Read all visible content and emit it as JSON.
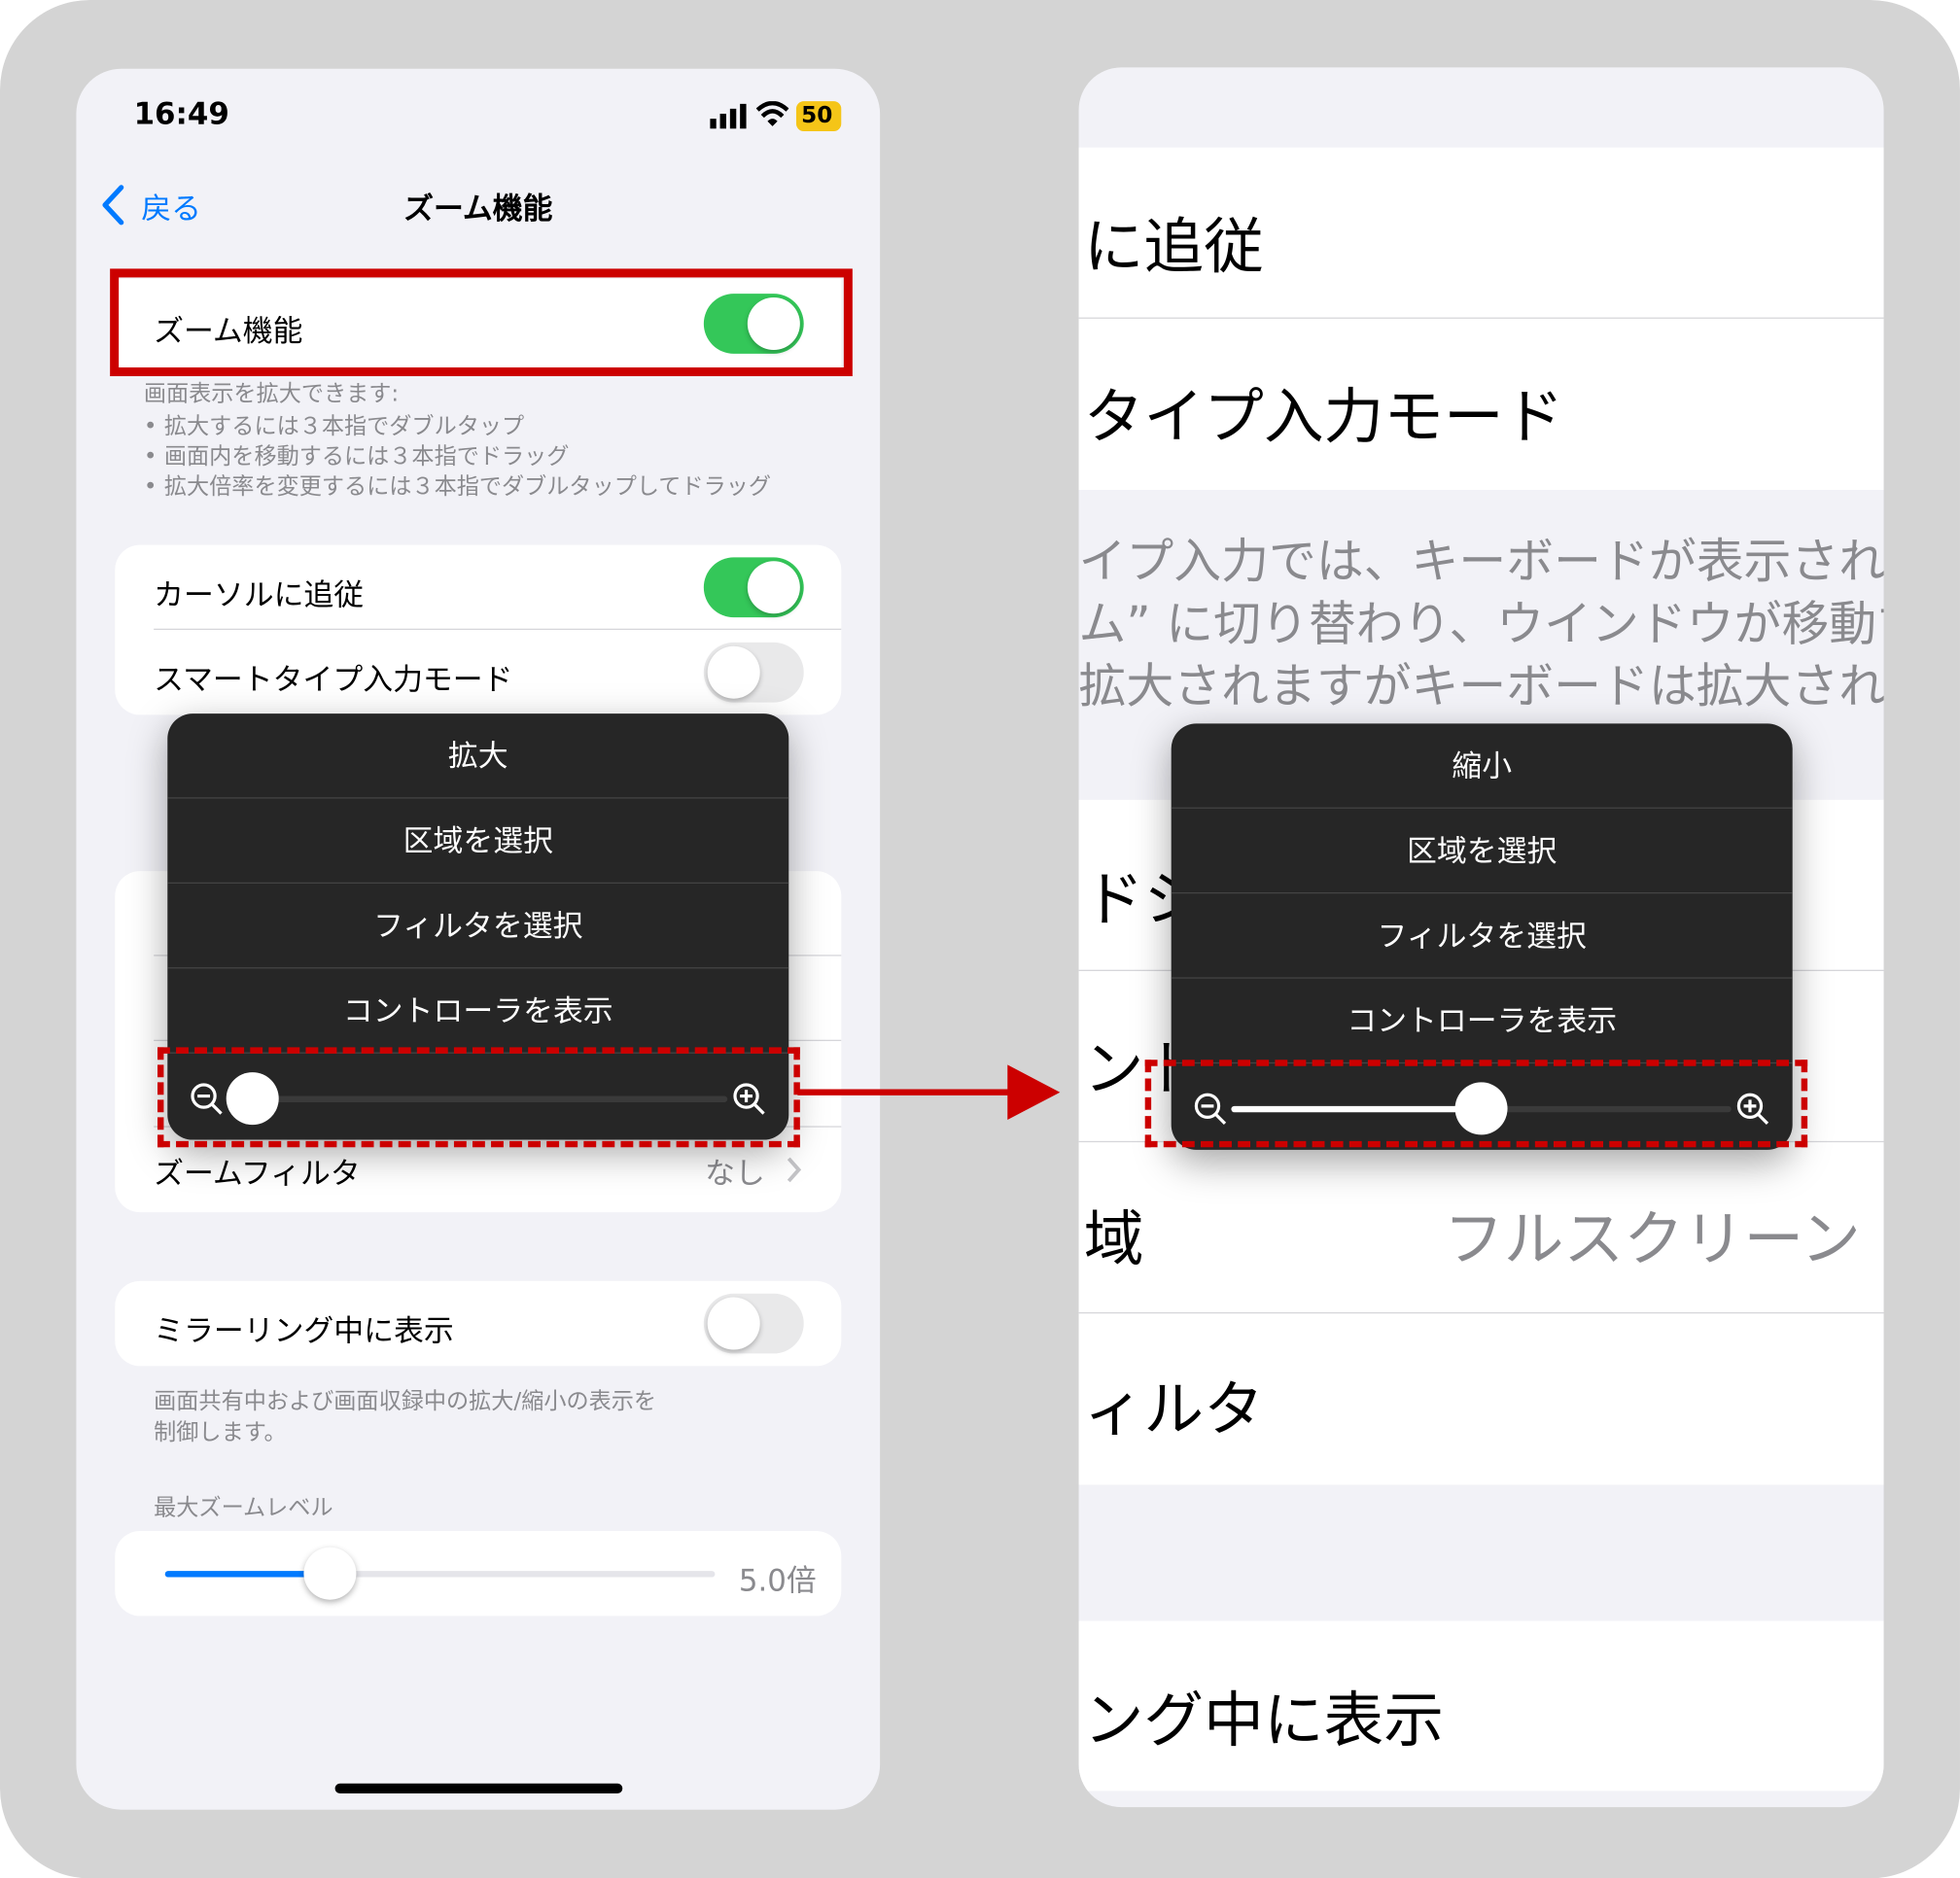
{
  "status_bar": {
    "time": "16:49",
    "battery": "50"
  },
  "nav": {
    "back_label": "戻る",
    "title": "ズーム機能"
  },
  "zoom_row": {
    "label": "ズーム機能"
  },
  "zoom_footer": {
    "heading": "画面表示を拡大できます:",
    "bullets": [
      "拡大するには３本指でダブルタップ",
      "画面内を移動するには３本指でドラッグ",
      "拡大倍率を変更するには３本指でダブルタップしてドラッグ"
    ]
  },
  "group2": {
    "follow_focus": "カーソルに追従",
    "smart_typing": "スマートタイプ入力モード"
  },
  "group3": {
    "zoom_filter": "ズームフィルタ",
    "zoom_filter_value": "なし"
  },
  "mirroring": {
    "label": "ミラーリング中に表示",
    "footer_line1": "画面共有中および画面収録中の拡大/縮小の表示を",
    "footer_line2": "制御します。"
  },
  "max_zoom": {
    "header": "最大ズームレベル",
    "value_label": "5.0倍",
    "level_fraction": 0.3
  },
  "left_menu": {
    "items": [
      "拡大",
      "区域を選択",
      "フィルタを選択",
      "コントローラを表示"
    ],
    "slider_fraction": 0.0
  },
  "right_view": {
    "rows": [
      "に追従",
      "タイプ入力モード",
      "ドシ",
      "ント",
      "域",
      "ィルタ",
      "ング中に表示"
    ],
    "region_value": "フルスクリーン",
    "footer_lines": [
      "イプ入力では、キーボードが表示され",
      "ム” に切り替わり、ウインドウが移動す",
      "拡大されますがキーボードは拡大されま"
    ]
  },
  "right_menu": {
    "items": [
      "縮小",
      "区域を選択",
      "フィルタを選択",
      "コントローラを表示"
    ],
    "slider_fraction": 0.5
  },
  "colors": {
    "accent": "#007aff",
    "toggle_on": "#34c759",
    "highlight": "#cc0000",
    "menu_bg": "#262626"
  }
}
